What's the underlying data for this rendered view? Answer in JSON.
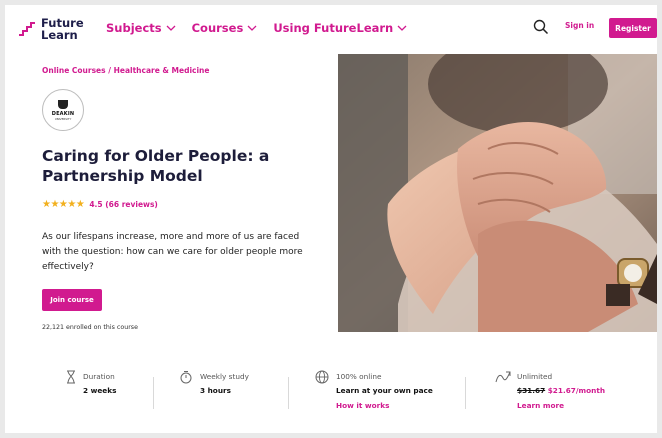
{
  "header": {
    "logo_line1": "Future",
    "logo_line2": "Learn",
    "nav": [
      {
        "label": "Subjects"
      },
      {
        "label": "Courses"
      },
      {
        "label": "Using FutureLearn"
      }
    ],
    "signin_label": "Sign in",
    "register_label": "Register"
  },
  "breadcrumb": {
    "item1": "Online Courses",
    "separator": " / ",
    "item2": "Healthcare & Medicine"
  },
  "provider": {
    "name": "DEAKIN",
    "sub": "UNIVERSITY"
  },
  "course": {
    "title": "Caring for Older People: a Partnership Model",
    "stars": "★★★★★",
    "rating": "4.5 (66 reviews)",
    "description": "As our lifespans increase, more and more of us are faced with the question: how can we care for older people more effectively?",
    "join_label": "Join course",
    "enrolled": "22,121 enrolled on this course"
  },
  "stats": {
    "duration_label": "Duration",
    "duration_value": "2 weeks",
    "weekly_label": "Weekly study",
    "weekly_value": "3 hours",
    "online_label": "100% online",
    "online_value": "Learn at your own pace",
    "online_link": "How it works",
    "unlimited_label": "Unlimited",
    "price_old": "$31.67",
    "price_new": "$21.67/month",
    "unlimited_link": "Learn more"
  },
  "colors": {
    "brand": "#d11a8f",
    "star": "#f2b01e"
  }
}
